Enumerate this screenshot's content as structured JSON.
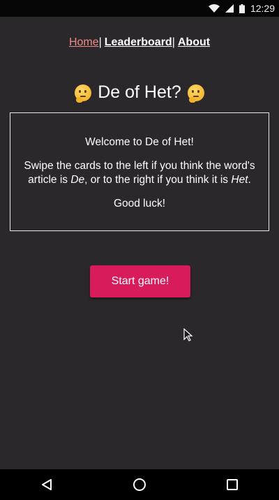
{
  "status_bar": {
    "time": "12:29"
  },
  "nav": {
    "home_label": "Home",
    "separator": "|",
    "leaderboard_label": "Leaderboard",
    "about_label": "About"
  },
  "header": {
    "title": "De of Het?"
  },
  "card": {
    "welcome": "Welcome to De of Het!",
    "instr_1": "Swipe the cards to the left if you think the word's article is ",
    "instr_de": "De",
    "instr_2": ", or to the right if you think it is ",
    "instr_het": "Het",
    "instr_3": ".",
    "good_luck": "Good luck!"
  },
  "actions": {
    "start_label": "Start game!"
  },
  "colors": {
    "background": "#2a282a",
    "accent_button": "#d81b5a",
    "active_link": "#f08a8a"
  },
  "icons": {
    "title_emoji": "thinking-face-icon",
    "nav_back": "back-triangle-icon",
    "nav_home": "home-circle-icon",
    "nav_recents": "recents-square-icon"
  }
}
